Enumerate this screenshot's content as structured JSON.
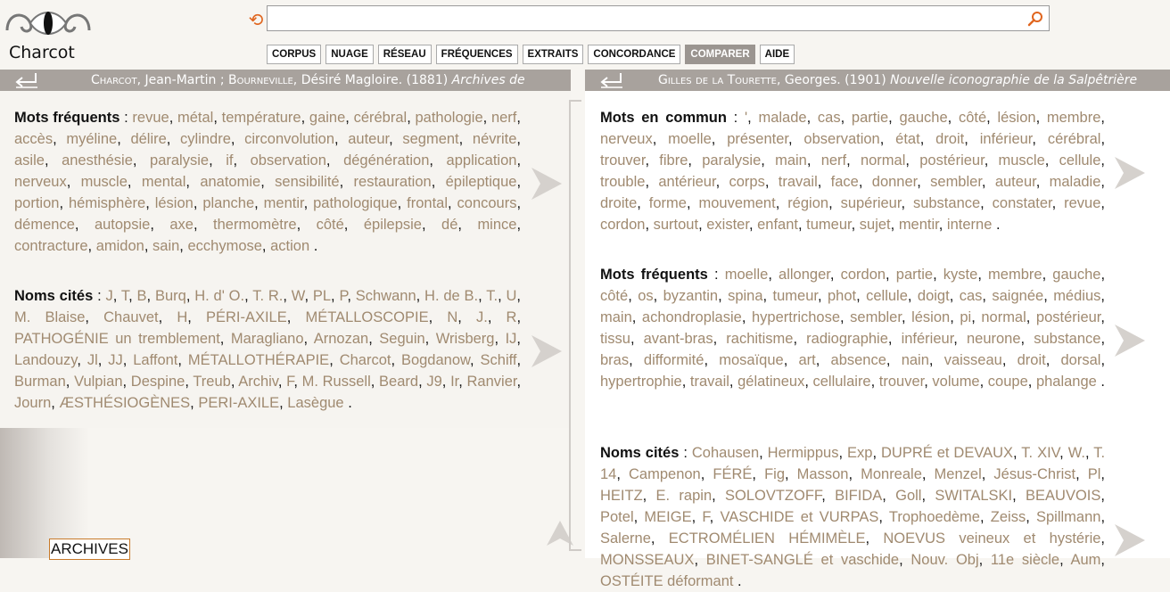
{
  "app": {
    "name": "Charcot"
  },
  "search": {
    "value": "",
    "placeholder": ""
  },
  "nav": {
    "buttons": [
      "CORPUS",
      "NUAGE",
      "RÉSEAU",
      "FRÉQUENCES",
      "EXTRAITS",
      "CONCORDANCE",
      "COMPARER",
      "AIDE"
    ],
    "active": "COMPARER"
  },
  "left": {
    "title": {
      "author1": "Charcot",
      "author1_rest": ", Jean-Martin ; ",
      "author2": "Bourneville",
      "author2_rest": ", Désiré Magloire. (1881) ",
      "work": "Archives de"
    },
    "sections": [
      {
        "label": "Mots fréquents",
        "words": [
          "revue",
          "métal",
          "température",
          "gaine",
          "cérébral",
          "pathologie",
          "nerf",
          "accès",
          "myéline",
          "délire",
          "cylindre",
          "circonvolution",
          "auteur",
          "segment",
          "névrite",
          "asile",
          "anesthésie",
          "paralysie",
          "if",
          "observation",
          "dégénération",
          "application",
          "nerveux",
          "muscle",
          "mental",
          "anatomie",
          "sensibilité",
          "restauration",
          "épileptique",
          "portion",
          "hémisphère",
          "lésion",
          "planche",
          "mentir",
          "pathologique",
          "frontal",
          "concours",
          "démence",
          "autopsie",
          "axe",
          "thermomètre",
          "côté",
          "épilepsie",
          "dé",
          "mince",
          "contracture",
          "amidon",
          "sain",
          "ecchymose",
          "action"
        ]
      },
      {
        "label": "Noms cités",
        "words": [
          "J",
          "T",
          "B",
          "Burq",
          "H. d' O.",
          "T. R.",
          "W",
          "PL",
          "P",
          "Schwann",
          "H. de B.",
          "T.",
          "U",
          "M. Blaise",
          "Chauvet",
          "H",
          "PÉRI-AXILE",
          "MÉTALLOSCOPIE",
          "N",
          "J.",
          "R",
          "PATHOGÉNIE un tremblement",
          "Maragliano",
          "Arnozan",
          "Seguin",
          "Wrisberg",
          "IJ",
          "Landouzy",
          "Jl",
          "JJ",
          "Laffont",
          "MÉTALLOTHÉRAPIE",
          "Charcot",
          "Bogdanow",
          "Schiff",
          "Burman",
          "Vulpian",
          "Despine",
          "Treub",
          "Archiv",
          "F",
          "M. Russell",
          "Beard",
          "J9",
          "Ir",
          "Ranvier",
          "Journ",
          "ÆSTHÉSIOGÈNES",
          "PERI-AXILE",
          "Lasègue"
        ]
      }
    ],
    "bottom_button": "ARCHIVES"
  },
  "right": {
    "title": {
      "author1": "Gilles de la Tourette",
      "author1_rest": ", Georges. (1901) ",
      "work": "Nouvelle iconographie de la Salpêtrière"
    },
    "sections": [
      {
        "label": "Mots en commun",
        "words": [
          "'",
          "malade",
          "cas",
          "partie",
          "gauche",
          "côté",
          "lésion",
          "membre",
          "nerveux",
          "moelle",
          "présenter",
          "observation",
          "état",
          "droit",
          "inférieur",
          "cérébral",
          "trouver",
          "fibre",
          "paralysie",
          "main",
          "nerf",
          "normal",
          "postérieur",
          "muscle",
          "cellule",
          "trouble",
          "antérieur",
          "corps",
          "travail",
          "face",
          "donner",
          "sembler",
          "auteur",
          "maladie",
          "droite",
          "forme",
          "mouvement",
          "région",
          "supérieur",
          "substance",
          "constater",
          "revue",
          "cordon",
          "surtout",
          "exister",
          "enfant",
          "tumeur",
          "sujet",
          "mentir",
          "interne"
        ]
      },
      {
        "label": "Mots fréquents",
        "words": [
          "moelle",
          "allonger",
          "cordon",
          "partie",
          "kyste",
          "membre",
          "gauche",
          "côté",
          "os",
          "byzantin",
          "spina",
          "tumeur",
          "phot",
          "cellule",
          "doigt",
          "cas",
          "saignée",
          "médius",
          "main",
          "achondroplasie",
          "hypertrichose",
          "sembler",
          "lésion",
          "pi",
          "normal",
          "postérieur",
          "tissu",
          "avant-bras",
          "rachitisme",
          "radiographie",
          "inférieur",
          "neurone",
          "substance",
          "bras",
          "difformité",
          "mosaïque",
          "art",
          "absence",
          "nain",
          "vaisseau",
          "droit",
          "dorsal",
          "hypertrophie",
          "travail",
          "gélatineux",
          "cellulaire",
          "trouver",
          "volume",
          "coupe",
          "phalange"
        ]
      },
      {
        "label": "Noms cités",
        "words": [
          "Cohausen",
          "Hermippus",
          "Exp",
          "DUPRÉ et DEVAUX",
          "T. XIV",
          "W.",
          "T. 14",
          "Campenon",
          "FÉRÉ",
          "Fig",
          "Masson",
          "Monreale",
          "Menzel",
          "Jésus-Christ",
          "Pl",
          "HEITZ",
          "E. rapin",
          "SOLOVTZOFF",
          "BIFIDA",
          "Goll",
          "SWITALSKI",
          "BEAUVOIS",
          "Potel",
          "MEIGE",
          "F",
          "VASCHIDE et VURPAS",
          "Trophoedème",
          "Zeiss",
          "Spillmann",
          "Salerne",
          "ECTROMÉLIEN HÉMIMÈLE",
          "NOEVUS veineux et hystérie",
          "MONSSEAUX",
          "BINET-SANGLÉ et vaschide",
          "Nouv. Obj",
          "11e siècle",
          "Aum",
          "OSTÉITE déformant"
        ]
      }
    ]
  },
  "colors": {
    "accent": "#e0651e",
    "word": "#a08a70",
    "titlebar": "#a8a29d",
    "active_button": "#9b9590"
  }
}
